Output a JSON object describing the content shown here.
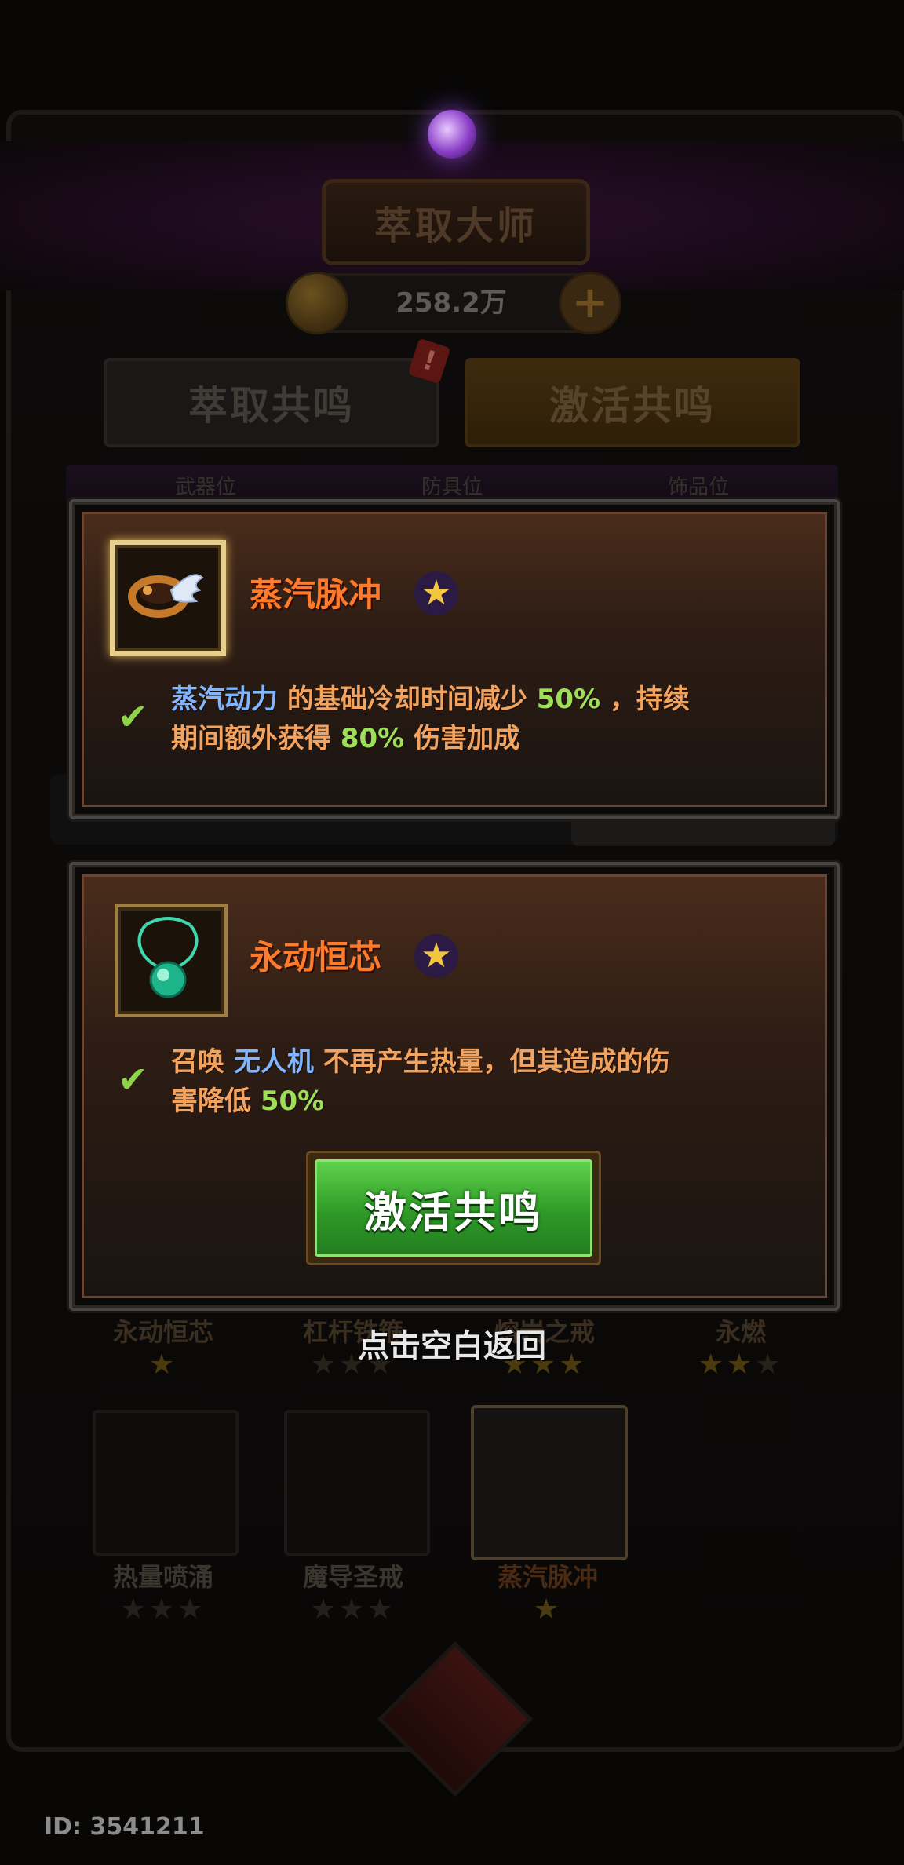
{
  "header": {
    "title": "萃取大师",
    "coin_amount": "258.2万",
    "plus_symbol": "+"
  },
  "tabs": [
    {
      "label": "萃取共鸣"
    },
    {
      "label": "激活共鸣"
    }
  ],
  "tab_badge": "!",
  "slots": [
    {
      "label": "武器位"
    },
    {
      "label": "防具位"
    },
    {
      "label": "饰品位"
    }
  ],
  "popups": [
    {
      "name": "蒸汽脉冲",
      "stars": 1,
      "desc_line1": {
        "kw": "蒸汽动力",
        "mid": "的基础冷却时间减少",
        "num": "50%",
        "tail": "，持续"
      },
      "desc_line2": {
        "head": "期间额外获得",
        "num": "80%",
        "tail": "伤害加成"
      }
    },
    {
      "name": "永动恒芯",
      "stars": 1,
      "desc_line1": {
        "head": "召唤",
        "kw": "无人机",
        "tail": "不再产生热量，但其造成的伤"
      },
      "desc_line2": {
        "head": "害降低",
        "num": "50%"
      },
      "button": "激活共鸣"
    }
  ],
  "back_hint": "点击空白返回",
  "background_items": [
    {
      "name": "永动恒芯",
      "stars_filled": 1,
      "stars_total": 1
    },
    {
      "name": "杠杆铁箍",
      "stars_filled": 0,
      "stars_total": 3
    },
    {
      "name": "熔岩之戒",
      "stars_filled": 3,
      "stars_total": 3
    },
    {
      "name": "永燃",
      "stars_filled": 2,
      "stars_total": 3
    },
    {
      "name": "热量喷涌",
      "stars_filled": 0,
      "stars_total": 3
    },
    {
      "name": "魔导圣戒",
      "stars_filled": 0,
      "stars_total": 3
    },
    {
      "name": "蒸汽脉冲",
      "stars_filled": 1,
      "stars_total": 1
    }
  ],
  "player_id": "ID: 3541211",
  "colors": {
    "title_orange": "#ff7a2a",
    "keyword_blue": "#7fb6ff",
    "number_green": "#9be056",
    "button_green": "#2e9a28",
    "star_gold": "#f3c640"
  }
}
